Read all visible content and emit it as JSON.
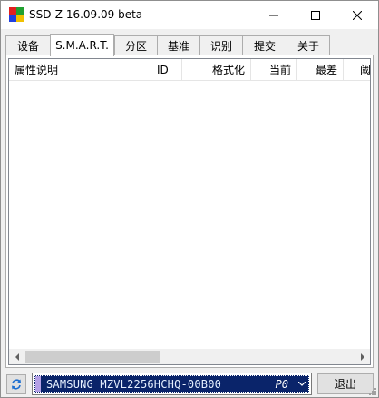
{
  "window": {
    "title": "SSD-Z 16.09.09 beta",
    "controls": {
      "minimize": "minimize-icon",
      "maximize": "maximize-icon",
      "close": "close-icon"
    }
  },
  "tabs": [
    {
      "label": "设备",
      "active": false
    },
    {
      "label": "S.M.A.R.T.",
      "active": true
    },
    {
      "label": "分区",
      "active": false
    },
    {
      "label": "基准",
      "active": false
    },
    {
      "label": "识别",
      "active": false
    },
    {
      "label": "提交",
      "active": false
    },
    {
      "label": "关于",
      "active": false
    }
  ],
  "smart_table": {
    "columns": [
      "属性说明",
      "ID",
      "格式化",
      "当前",
      "最差",
      "阈"
    ],
    "rows": []
  },
  "footer": {
    "drive_label": "SAMSUNG MZVL2256HCHQ-00B00",
    "drive_tag": "P0",
    "exit_label": "退出",
    "refresh_icon": "refresh-icon"
  },
  "colors": {
    "selection": "#0a246a",
    "stripe": "#b4a0e6"
  }
}
